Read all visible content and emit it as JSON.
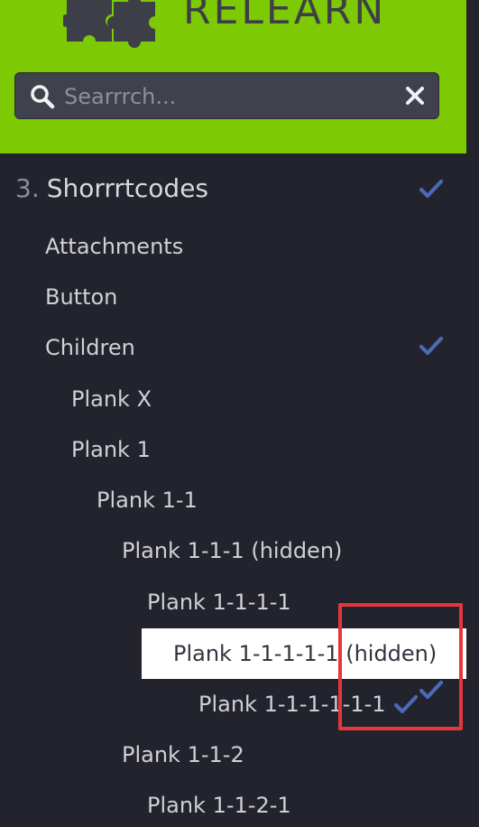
{
  "header": {
    "logo_text": "RELEARN",
    "search_placeholder": "Searrrch..."
  },
  "nav": {
    "section": {
      "number": "3.",
      "label": "Shorrrtcodes",
      "visited": true
    },
    "items": [
      {
        "label": "Attachments",
        "level": 1,
        "visited": false
      },
      {
        "label": "Button",
        "level": 1,
        "visited": false
      },
      {
        "label": "Children",
        "level": 1,
        "visited": true
      },
      {
        "label": "Plank X",
        "level": 2,
        "visited": false
      },
      {
        "label": "Plank 1",
        "level": 2,
        "visited": false
      },
      {
        "label": "Plank 1-1",
        "level": 3,
        "visited": false
      },
      {
        "label": "Plank 1-1-1 (hidden)",
        "level": 4,
        "visited": false
      },
      {
        "label": "Plank 1-1-1-1",
        "level": 5,
        "visited": false
      },
      {
        "label": "Plank 1-1-1-1-1 (hidden)",
        "level": 6,
        "visited": false,
        "active": true
      },
      {
        "label": "Plank 1-1-1-1-1-1",
        "level": 7,
        "visited": true
      },
      {
        "label": "Plank 1-1-2",
        "level": 4,
        "visited": false
      },
      {
        "label": "Plank 1-1-2-1",
        "level": 5,
        "visited": false
      }
    ]
  },
  "colors": {
    "header_bg": "#7dc903",
    "sidebar_bg": "#22232c",
    "check": "#4b69b8",
    "highlight_border": "#e5363b"
  }
}
